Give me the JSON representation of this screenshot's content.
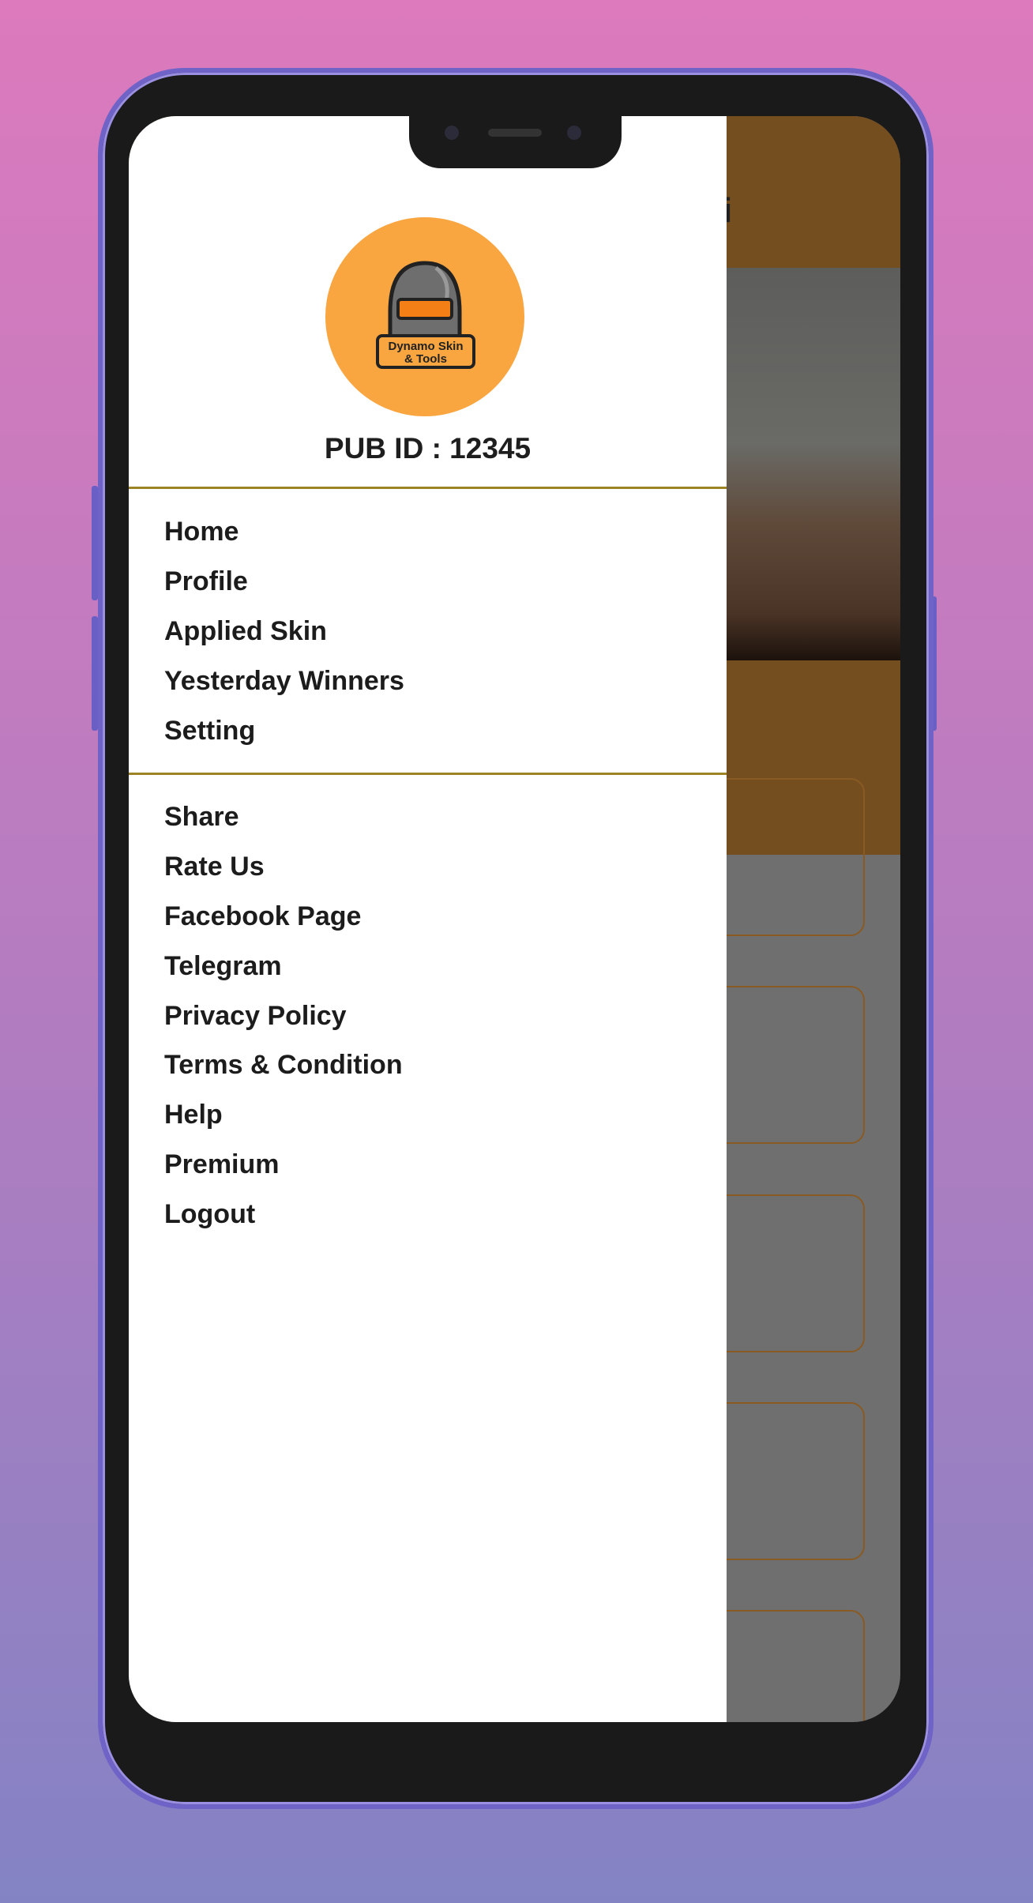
{
  "app": {
    "header_title_fragment": "i",
    "logo_text": "Dynamo Skin & Tools",
    "pub_id": "PUB ID : 12345"
  },
  "drawer": {
    "primary_items": [
      {
        "label": "Home"
      },
      {
        "label": "Profile"
      },
      {
        "label": "Applied Skin"
      },
      {
        "label": "Yesterday Winners"
      },
      {
        "label": "Setting"
      }
    ],
    "secondary_items": [
      {
        "label": "Share"
      },
      {
        "label": "Rate Us"
      },
      {
        "label": "Facebook Page"
      },
      {
        "label": "Telegram"
      },
      {
        "label": "Privacy Policy"
      },
      {
        "label": "Terms & Condition"
      },
      {
        "label": "Help"
      },
      {
        "label": "Premium"
      },
      {
        "label": "Logout"
      }
    ]
  },
  "colors": {
    "header_brown": "#744e1f",
    "logo_orange": "#f9a540",
    "divider_gold": "#9c8424",
    "scrim_gray": "#6f6f6f"
  }
}
